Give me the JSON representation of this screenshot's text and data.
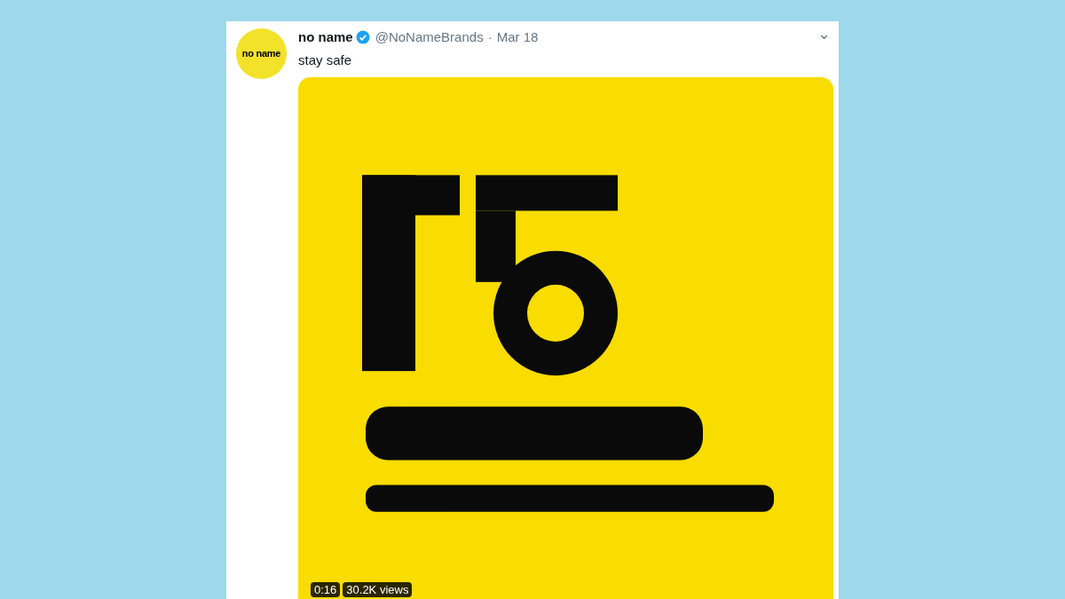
{
  "tweet": {
    "avatar_label": "no name",
    "author": "no name",
    "verified": true,
    "handle": "@NoNameBrands",
    "separator": "·",
    "date": "Mar 18",
    "menu_glyph": "⌄",
    "text": "stay safe",
    "video": {
      "kind": "picture",
      "duration": "0:16",
      "views": "30.2K views"
    }
  }
}
